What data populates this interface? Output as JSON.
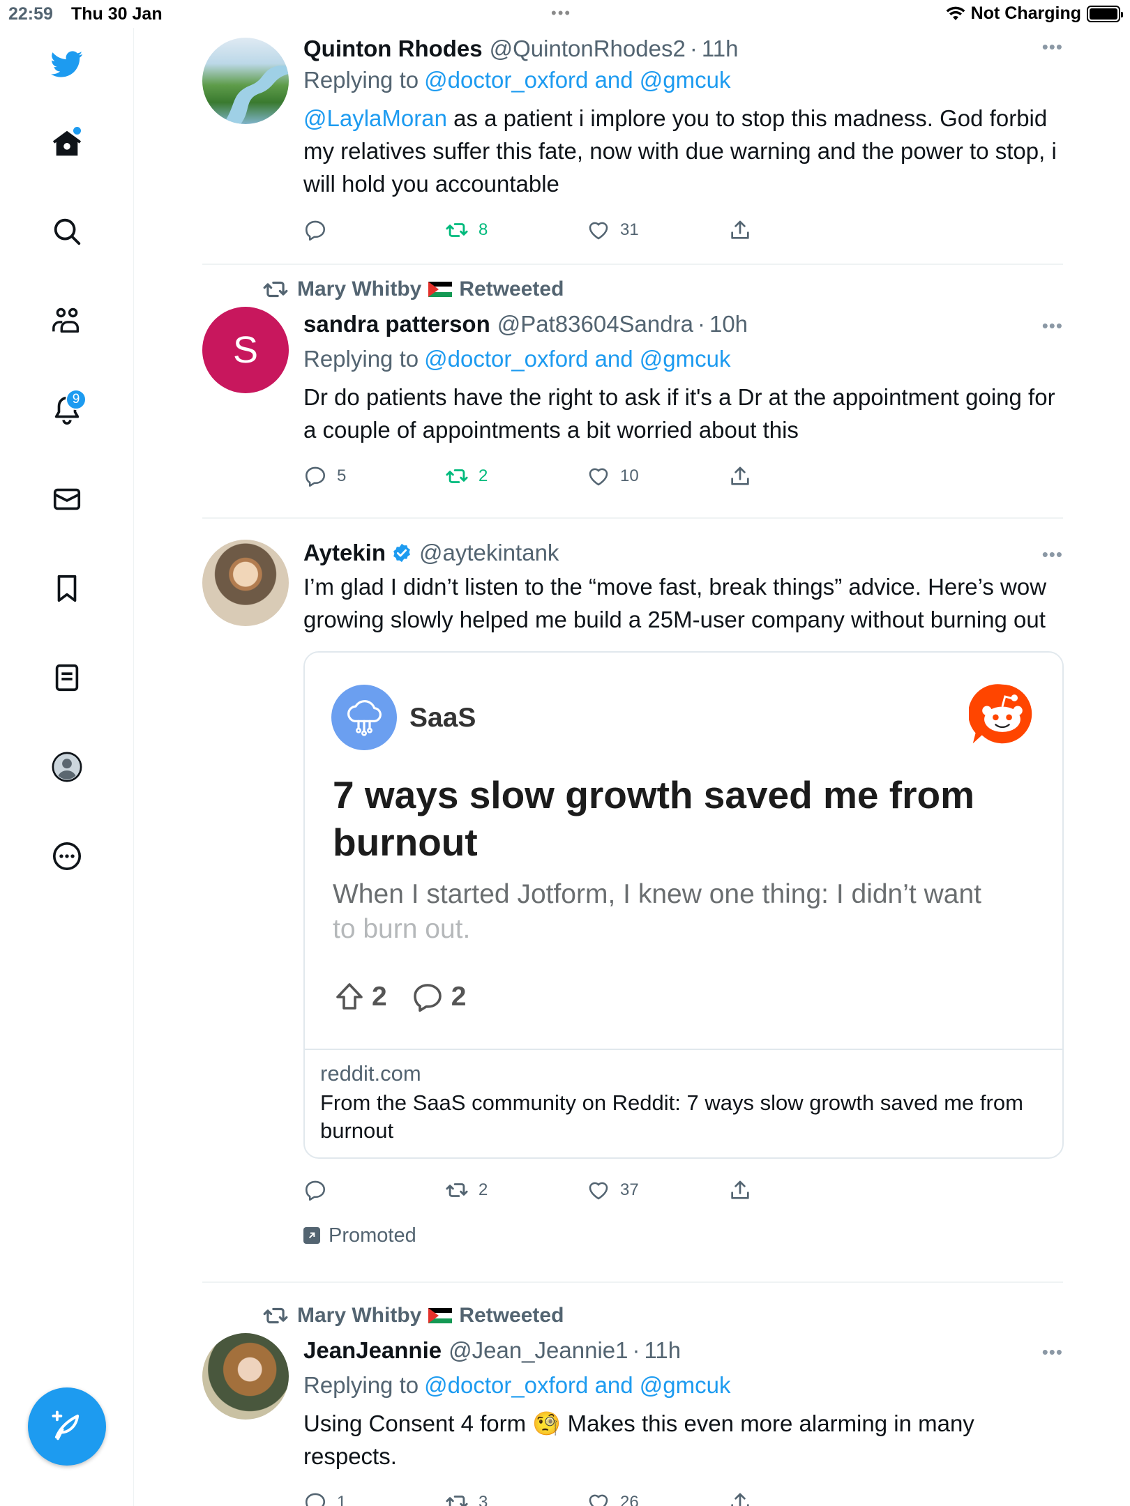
{
  "status_bar": {
    "time": "22:59",
    "date": "Thu 30 Jan",
    "charging": "Not Charging"
  },
  "sidebar": {
    "notifications_badge": "9",
    "accent_color": "#1d9bf0"
  },
  "tweets": [
    {
      "name": "Quinton Rhodes",
      "handle": "@QuintonRhodes2",
      "time": "11h",
      "replying_prefix": "Replying to",
      "replying_to": "@doctor_oxford and @gmcuk",
      "mention": "@LaylaMoran",
      "text": " as a patient i implore you to stop this madness. God forbid my relatives suffer this fate, now with due warning and the power to stop, i will hold you accountable",
      "replies": "",
      "retweets": "8",
      "likes": "31"
    },
    {
      "retweeted_by": "Mary Whitby",
      "retweeted_label": "Retweeted",
      "avatar_letter": "S",
      "name": "sandra patterson",
      "handle": "@Pat83604Sandra",
      "time": "10h",
      "replying_prefix": "Replying to",
      "replying_to": "@doctor_oxford and @gmcuk",
      "text": "Dr do patients have the right to ask if it's a Dr  at the appointment going for a couple of appointments a bit worried about this",
      "replies": "5",
      "retweets": "2",
      "likes": "10"
    },
    {
      "name": "Aytekin",
      "handle": "@aytekintank",
      "text": "I’m glad I didn’t listen to the “move fast, break things” advice. Here’s wow growing slowly helped me build a 25M-user company without burning out",
      "card": {
        "community": "SaaS",
        "title": "7 ways slow growth saved me from burnout",
        "desc": "When I started Jotform, I knew one thing: I didn’t want",
        "desc_fade": "to burn out.",
        "upvotes": "2",
        "comments": "2",
        "domain": "reddit.com",
        "meta_title": "From the SaaS community on Reddit: 7 ways slow growth saved me from burnout"
      },
      "replies": "",
      "retweets": "2",
      "likes": "37",
      "promoted": "Promoted"
    },
    {
      "retweeted_by": "Mary Whitby",
      "retweeted_label": "Retweeted",
      "name": "JeanJeannie",
      "handle": "@Jean_Jeannie1",
      "time": "11h",
      "replying_prefix": "Replying to",
      "replying_to": "@doctor_oxford and @gmcuk",
      "text_before": "Using Consent 4 form ",
      "emoji": "🧐",
      "text_after": " Makes this even more alarming in many respects.",
      "replies": "1",
      "retweets": "3",
      "likes": "26"
    }
  ]
}
